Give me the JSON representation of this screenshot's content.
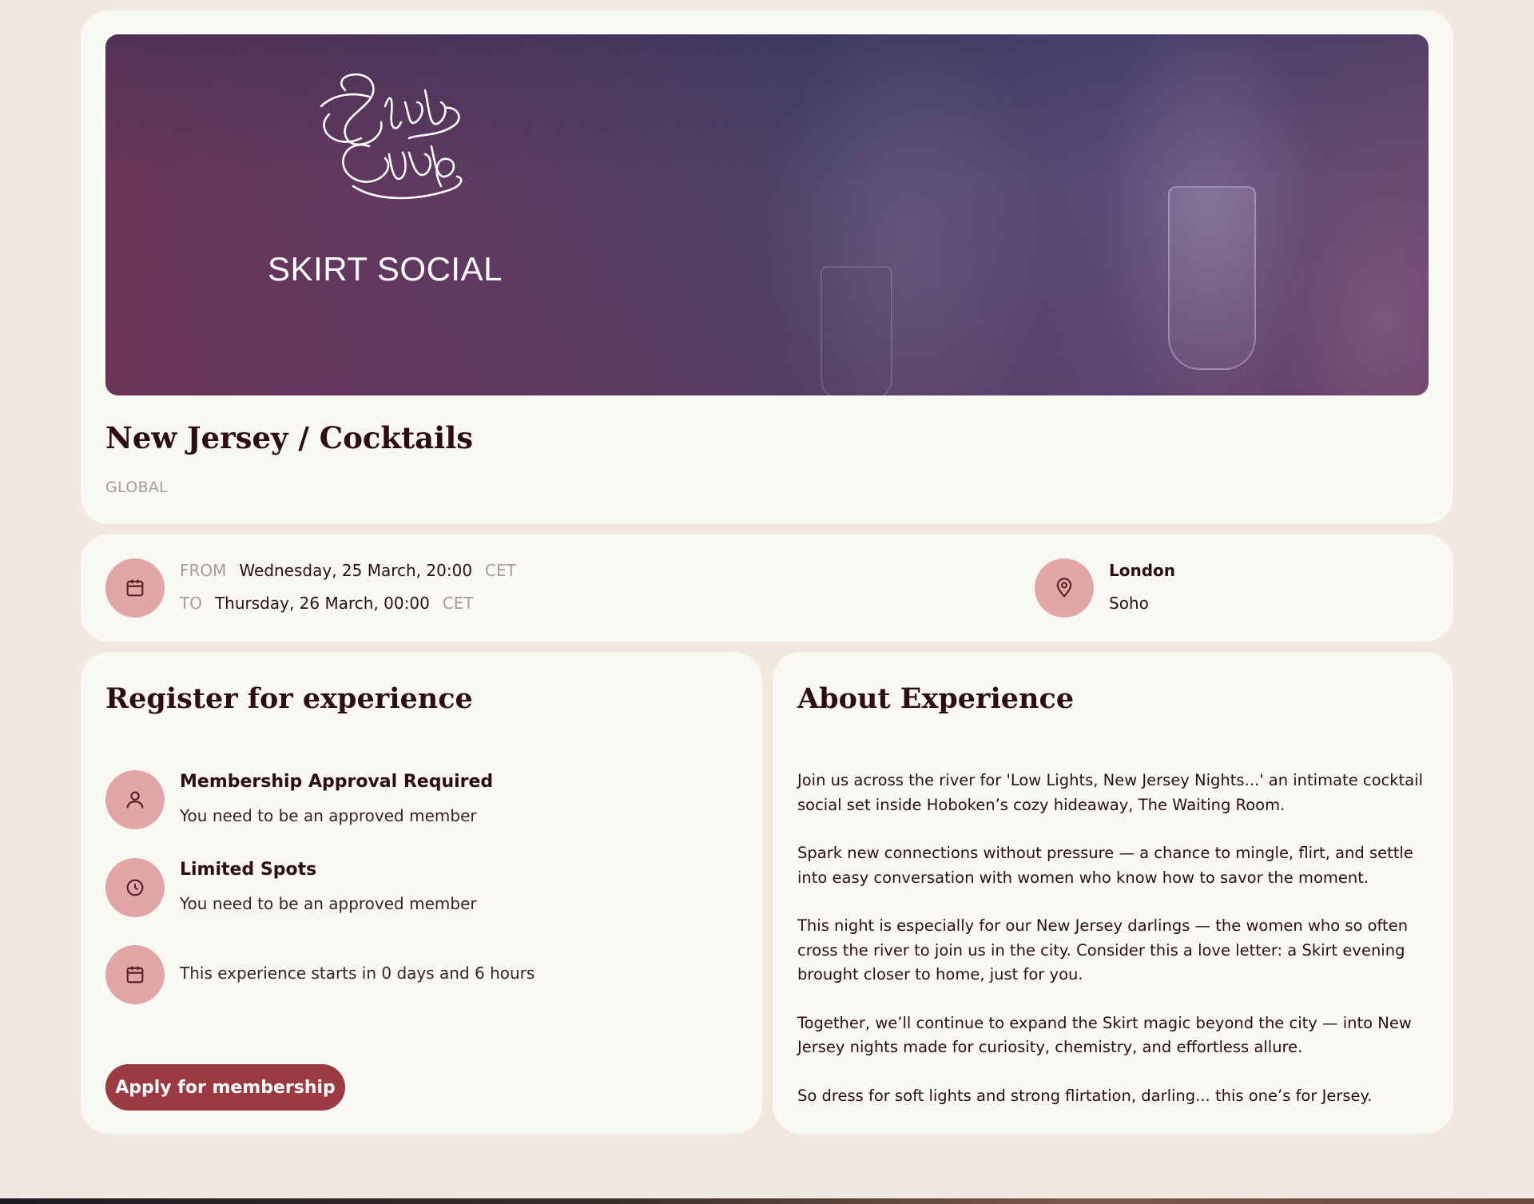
{
  "hero": {
    "brand_line": "SKIRT SOCIAL",
    "logo_text": "Skirt Club"
  },
  "event": {
    "title": "New Jersey / Cocktails",
    "region": "GLOBAL"
  },
  "schedule": {
    "from_label": "FROM",
    "from_value": "Wednesday, 25 March, 20:00",
    "from_tz": "CET",
    "to_label": "TO",
    "to_value": "Thursday, 26 March, 00:00",
    "to_tz": "CET"
  },
  "location": {
    "city": "London",
    "area": "Soho"
  },
  "register": {
    "heading": "Register for experience",
    "items": [
      {
        "title": "Membership Approval Required",
        "subtitle": "You need to be an approved member",
        "icon": "user-icon"
      },
      {
        "title": "Limited Spots",
        "subtitle": "You need to be an approved member",
        "icon": "clock-icon"
      },
      {
        "title": "",
        "subtitle": "This experience starts in 0 days and 6 hours",
        "icon": "calendar-icon"
      }
    ],
    "apply_label": "Apply for membership"
  },
  "about": {
    "heading": "About Experience",
    "paragraphs": [
      "Join us across the river for 'Low Lights, New Jersey Nights...'  an intimate cocktail social set inside Hoboken’s cozy hideaway, The Waiting Room.",
      "Spark new connections without pressure — a chance to mingle, flirt, and settle into easy conversation with women who know how to savor the moment.",
      "This night is especially for our New Jersey darlings — the women who so often cross the river to join us in the city. Consider this a love letter: a Skirt evening brought closer to home, just for you.",
      "Together, we’ll continue to expand the Skirt magic beyond the city — into New Jersey nights made for curiosity, chemistry, and effortless allure.",
      "So dress for soft lights and strong flirtation, darling... this one’s for Jersey."
    ]
  },
  "colors": {
    "page_bg": "#f1e9e0",
    "card_bg": "#fbf9f5",
    "icon_circle": "#e3a6a7",
    "primary_button": "#9c3a41",
    "text": "#2e0d12",
    "muted": "#a89b9b"
  }
}
